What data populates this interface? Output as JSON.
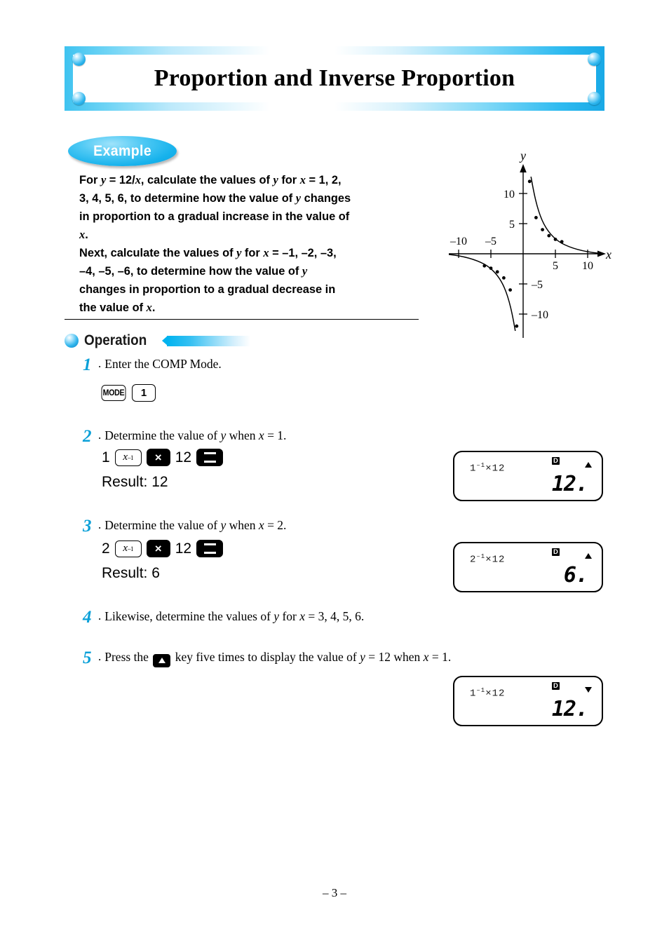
{
  "page": {
    "title": "Proportion and Inverse Proportion",
    "footer": "– 3 –",
    "accent_color": "#0aa0d8",
    "banner_color": "#2ebaf0"
  },
  "example": {
    "badge_label": "Example",
    "problem_lines": [
      "For <i>y</i> = 12/<i>x</i>, calculate the values of <i>y</i> for <i>x</i> = 1, 2,",
      "3, 4, 5, 6, to determine how the value of <i>y</i> changes",
      "in proportion to a gradual increase in the value of",
      "<i>x</i>.",
      "Next, calculate the values of <i>y</i> for <i>x</i> = –1, –2, –3,",
      "–4, –5, –6, to determine how the value of <i>y</i>",
      "changes in proportion to a gradual decrease in",
      "the value of <i>x</i>."
    ]
  },
  "operation": {
    "label": "Operation"
  },
  "steps": [
    {
      "number": "1",
      "dot": ".",
      "text": "Enter the COMP Mode.",
      "keys": [
        "MODE",
        "1"
      ]
    },
    {
      "number": "2",
      "dot": ".",
      "text": "Determine the value of <i>y</i> when <i>x</i> = 1.",
      "keys": [
        "1",
        "x-inverse",
        "multiply",
        "12",
        "equals"
      ],
      "key_tokens": {
        "first": "1",
        "second": "12",
        "xinv_base": "x",
        "xinv_exp": "–1",
        "mult": "×"
      },
      "result": "Result: 12"
    },
    {
      "number": "3",
      "dot": ".",
      "text": "Determine the value of <i>y</i> when <i>x</i> = 2.",
      "keys": [
        "2",
        "x-inverse",
        "multiply",
        "12",
        "equals"
      ],
      "key_tokens": {
        "first": "2",
        "second": "12",
        "xinv_base": "x",
        "xinv_exp": "–1",
        "mult": "×"
      },
      "result": "Result: 6"
    },
    {
      "number": "4",
      "dot": ".",
      "text": "Likewise, determine the values of <i>y</i> for <i>x</i> = 3, 4, 5, 6."
    },
    {
      "number": "5",
      "dot": ".",
      "text_before": "Press the",
      "text_after": "key five times to display the value of <i>y</i> = 12 when <i>x</i> = 1.",
      "inline_key": "up-arrow"
    }
  ],
  "displays": [
    {
      "expression_base": "1",
      "expression_exp": "–1",
      "expression_tail": "×12",
      "mode_indicator": "D",
      "scroll_arrow": "up",
      "result": "12."
    },
    {
      "expression_base": "2",
      "expression_exp": "–1",
      "expression_tail": "×12",
      "mode_indicator": "D",
      "scroll_arrow": "up",
      "result": "6."
    },
    {
      "expression_base": "1",
      "expression_exp": "–1",
      "expression_tail": "×12",
      "mode_indicator": "D",
      "scroll_arrow": "down",
      "result": "12."
    }
  ],
  "chart_data": {
    "type": "line",
    "title": "",
    "xlabel": "x",
    "ylabel": "y",
    "xlim": [
      -12,
      12
    ],
    "ylim": [
      -13,
      13
    ],
    "grid": false,
    "x_ticks": [
      -10,
      -5,
      5,
      10
    ],
    "y_ticks": [
      10,
      5,
      -5,
      -10
    ],
    "x_tick_labels": [
      "–10",
      "–5",
      "5",
      "10"
    ],
    "y_tick_labels": [
      "10",
      "5",
      "–5",
      "–10"
    ],
    "function": "y = 12/x",
    "series": [
      {
        "name": "positive branch",
        "x": [
          1,
          2,
          3,
          4,
          5,
          6
        ],
        "y": [
          12,
          6,
          4,
          3,
          2.4,
          2
        ]
      },
      {
        "name": "negative branch",
        "x": [
          -1,
          -2,
          -3,
          -4,
          -5,
          -6
        ],
        "y": [
          -12,
          -6,
          -4,
          -3,
          -2.4,
          -2
        ]
      }
    ]
  }
}
